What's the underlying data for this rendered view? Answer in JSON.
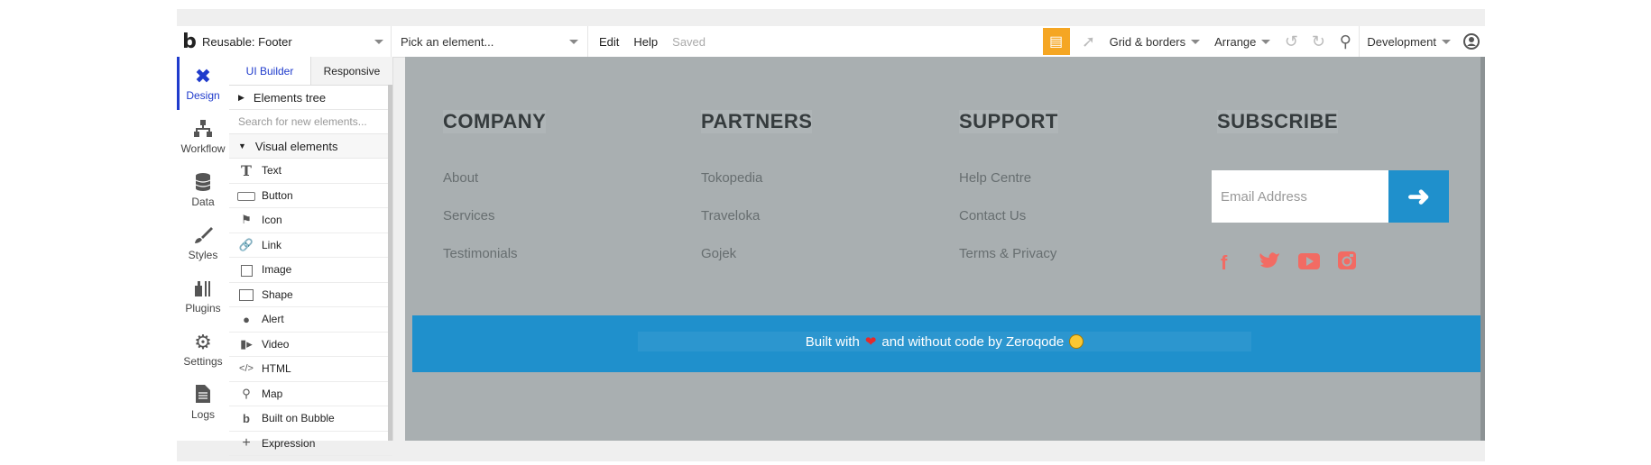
{
  "topbar": {
    "page_name": "Reusable: Footer",
    "pick_placeholder": "Pick an element...",
    "menu_edit": "Edit",
    "menu_help": "Help",
    "saved_status": "Saved",
    "grid_borders": "Grid & borders",
    "arrange": "Arrange",
    "environment": "Development"
  },
  "leftnav": {
    "items": [
      {
        "label": "Design",
        "icon": "design-icon"
      },
      {
        "label": "Workflow",
        "icon": "workflow-icon"
      },
      {
        "label": "Data",
        "icon": "database-icon"
      },
      {
        "label": "Styles",
        "icon": "brush-icon"
      },
      {
        "label": "Plugins",
        "icon": "plugin-icon"
      },
      {
        "label": "Settings",
        "icon": "gear-icon"
      },
      {
        "label": "Logs",
        "icon": "document-icon"
      }
    ]
  },
  "panel": {
    "tab_ui_builder": "UI Builder",
    "tab_responsive": "Responsive",
    "elements_tree": "Elements tree",
    "search_placeholder": "Search for new elements...",
    "visual_elements": "Visual elements",
    "elements": [
      {
        "label": "Text",
        "icon": "text-icon"
      },
      {
        "label": "Button",
        "icon": "button-icon"
      },
      {
        "label": "Icon",
        "icon": "flag-icon"
      },
      {
        "label": "Link",
        "icon": "link-icon"
      },
      {
        "label": "Image",
        "icon": "image-icon"
      },
      {
        "label": "Shape",
        "icon": "shape-icon"
      },
      {
        "label": "Alert",
        "icon": "bell-icon"
      },
      {
        "label": "Video",
        "icon": "video-icon"
      },
      {
        "label": "HTML",
        "icon": "code-icon"
      },
      {
        "label": "Map",
        "icon": "map-pin-icon"
      },
      {
        "label": "Built on Bubble",
        "icon": "bubble-logo-icon"
      },
      {
        "label": "Expression",
        "icon": "plus-icon"
      }
    ]
  },
  "footer": {
    "columns": [
      {
        "title": "COMPANY",
        "links": [
          "About",
          "Services",
          "Testimonials"
        ]
      },
      {
        "title": "PARTNERS",
        "links": [
          "Tokopedia",
          "Traveloka",
          "Gojek"
        ]
      },
      {
        "title": "SUPPORT",
        "links": [
          "Help Centre",
          "Contact Us",
          "Terms & Privacy"
        ]
      }
    ],
    "subscribe_title": "SUBSCRIBE",
    "email_placeholder": "Email Address",
    "social": [
      "facebook-icon",
      "twitter-icon",
      "youtube-icon",
      "instagram-icon"
    ],
    "bottom_prefix": "Built with",
    "bottom_suffix": "and without code by Zeroqode"
  },
  "colors": {
    "accent": "#1f90cc",
    "canvas": "#a9afb1",
    "social": "#f26b63",
    "gift": "#f5a623",
    "active_nav": "#1f3bcc"
  }
}
